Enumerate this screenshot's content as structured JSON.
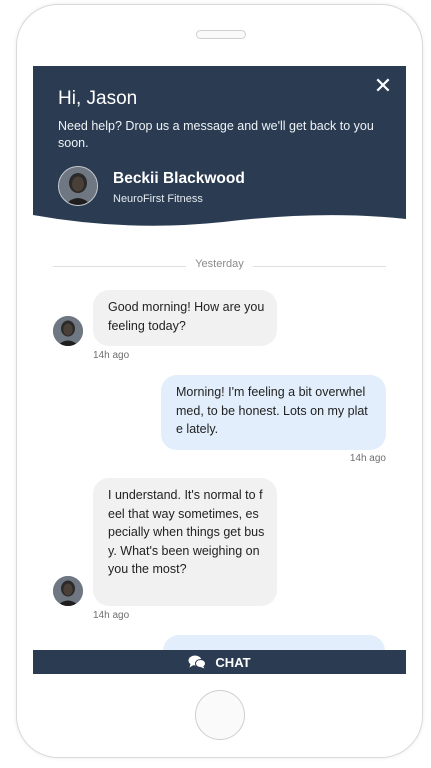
{
  "header": {
    "greeting": "Hi, Jason",
    "help_text": "Need help? Drop us a message and we'll get back to you soon.",
    "agent_name": "Beckii Blackwood",
    "agent_company": "NeuroFirst Fitness",
    "close_icon": "close-icon",
    "bg_color": "#2b3c52"
  },
  "conversation": {
    "day_label": "Yesterday",
    "messages": [
      {
        "direction": "incoming",
        "text": "Good morning! How are you feeling today?",
        "time": "14h ago"
      },
      {
        "direction": "outgoing",
        "text": "Morning! I'm feeling a bit overwhelmed, to be honest. Lots on my plate lately.",
        "time": "14h ago"
      },
      {
        "direction": "incoming",
        "text": "I understand. It's normal to feel that way sometimes, especially when things get busy. What's been weighing on you the most?",
        "time": "14h ago"
      }
    ],
    "incoming_bubble_color": "#f1f1f1",
    "outgoing_bubble_color": "#e2eefb"
  },
  "footer": {
    "chat_label": "CHAT",
    "chat_icon": "chat-bubbles-icon"
  }
}
